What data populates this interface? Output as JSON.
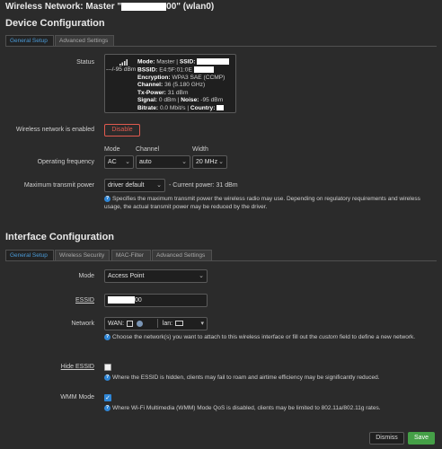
{
  "header": {
    "title_prefix": "Wireless Network: Master \"",
    "title_ssid_tail": "00",
    "title_suffix": "\" (wlan0)"
  },
  "device_config": {
    "heading": "Device Configuration",
    "tabs": [
      {
        "label": "General Setup",
        "active": true
      },
      {
        "label": "Advanced Settings",
        "active": false
      }
    ],
    "status": {
      "label": "Status",
      "signal_text": "---/-95 dBm",
      "mode_label": "Mode:",
      "mode_value": "Master |",
      "ssid_label": "SSID:",
      "bssid_label": "BSSID:",
      "bssid_value": "E4:5F:01:0E",
      "encryption_label": "Encryption:",
      "encryption_value": "WPA3 SAE (CCMP)",
      "channel_label": "Channel:",
      "channel_value": "36 (5.180 GHz)",
      "txpower_label": "Tx-Power:",
      "txpower_value": "31 dBm",
      "signal_label": "Signal:",
      "signal_value": "0 dBm |",
      "noise_label": "Noise:",
      "noise_value": "-95 dBm",
      "bitrate_label": "Bitrate:",
      "bitrate_value": "0.0 Mbit/s |",
      "country_label": "Country:"
    },
    "enabled": {
      "label": "Wireless network is enabled",
      "button": "Disable"
    },
    "frequency": {
      "label": "Operating frequency",
      "mode_col": "Mode",
      "channel_col": "Channel",
      "width_col": "Width",
      "mode_value": "AC",
      "channel_value": "auto",
      "width_value": "20 MHz"
    },
    "txpower": {
      "label": "Maximum transmit power",
      "value": "driver default",
      "current": "- Current power: 31 dBm",
      "hint": "Specifies the maximum transmit power the wireless radio may use. Depending on regulatory requirements and wireless usage, the actual transmit power may be reduced by the driver."
    }
  },
  "interface_config": {
    "heading": "Interface Configuration",
    "tabs": [
      {
        "label": "General Setup",
        "active": true
      },
      {
        "label": "Wireless Security",
        "active": false
      },
      {
        "label": "MAC-Filter",
        "active": false
      },
      {
        "label": "Advanced Settings",
        "active": false
      }
    ],
    "mode": {
      "label": "Mode",
      "value": "Access Point"
    },
    "essid": {
      "label": "ESSID",
      "value_tail": "00"
    },
    "network": {
      "label": "Network",
      "wan": "WAN:",
      "lan": "lan:",
      "hint_pre": "Choose the network(s) you want to attach to this wireless interface or fill out the ",
      "hint_em": "custom",
      "hint_post": " field to define a new network."
    },
    "hide_essid": {
      "label": "Hide ESSID",
      "checked": false,
      "hint": "Where the ESSID is hidden, clients may fail to roam and airtime efficiency may be significantly reduced."
    },
    "wmm": {
      "label": "WMM Mode",
      "checked": true,
      "hint": "Where Wi-Fi Multimedia (WMM) Mode QoS is disabled, clients may be limited to 802.11a/802.11g rates."
    }
  },
  "footer": {
    "dismiss": "Dismiss",
    "save": "Save"
  },
  "colors": {
    "background": "#2b2b2b",
    "accent": "#4a9bd8",
    "danger": "#e05a4f",
    "save": "#45a047"
  }
}
